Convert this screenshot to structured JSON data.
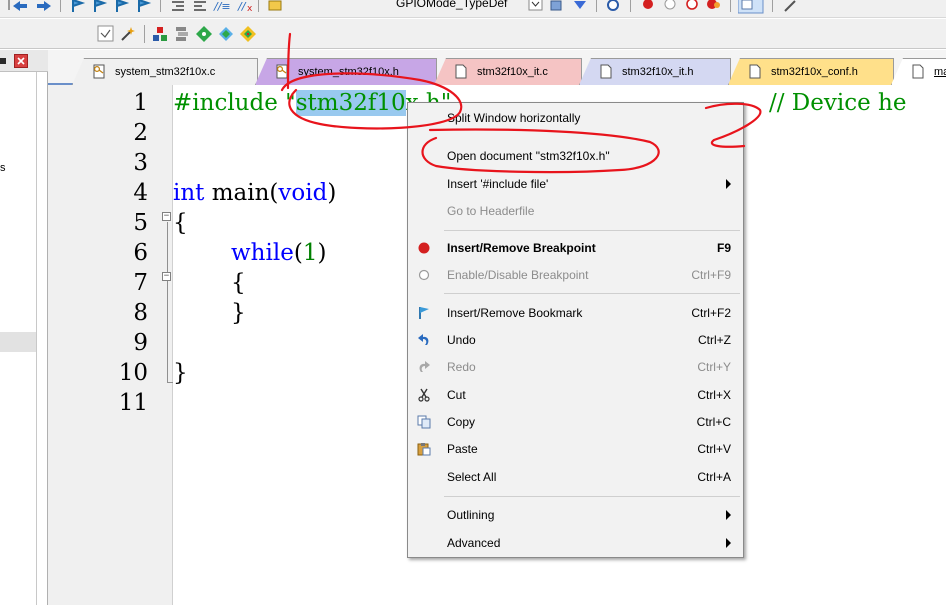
{
  "toolbar": {
    "combo_value": "GPIOMode_TypeDef"
  },
  "left_panel": {
    "partial_text": "s"
  },
  "tabs": [
    {
      "label": "system_stm32f10x.c",
      "color": "#f0f0f0",
      "icon": "file-key-icon"
    },
    {
      "label": "system_stm32f10x.h",
      "color": "#c7a6e6",
      "icon": "file-key-icon"
    },
    {
      "label": "stm32f10x_it.c",
      "color": "#f5c4c4",
      "icon": "file-icon"
    },
    {
      "label": "stm32f10x_it.h",
      "color": "#d4d8f2",
      "icon": "file-icon"
    },
    {
      "label": "stm32f10x_conf.h",
      "color": "#ffe08a",
      "icon": "file-icon"
    },
    {
      "label": "mai",
      "color": "#ffffff",
      "icon": "file-icon"
    }
  ],
  "editor": {
    "line_numbers": [
      "1",
      "2",
      "3",
      "4",
      "5",
      "6",
      "7",
      "8",
      "9",
      "10",
      "11"
    ],
    "code": {
      "l1_directive": "#include",
      "l1_quote_open": " \"",
      "l1_selected": "stm32f10",
      "l1_rest": "x.h\"",
      "l1_comment": "// Device he",
      "l4_type": "int",
      "l4_name": " main(",
      "l4_param": "void",
      "l4_close": ")",
      "l5": "{",
      "l6_kw": "while",
      "l6_open": "(",
      "l6_num": "1",
      "l6_close": ")",
      "l7": "{",
      "l8": "}",
      "l10": "}"
    }
  },
  "context_menu": {
    "items": [
      {
        "label": "Split Window horizontally",
        "shortcut": "",
        "icon": ""
      },
      {
        "label": "Open document \"stm32f10x.h\"",
        "shortcut": "",
        "icon": ""
      },
      {
        "label": "Insert '#include file'",
        "shortcut": "",
        "icon": "",
        "submenu": true
      },
      {
        "label": "Go to Headerfile",
        "shortcut": "",
        "icon": "",
        "disabled": true
      },
      {
        "label": "Insert/Remove Breakpoint",
        "shortcut": "F9",
        "icon": "breakpoint-icon",
        "bold": true
      },
      {
        "label": "Enable/Disable Breakpoint",
        "shortcut": "Ctrl+F9",
        "icon": "breakpoint-disable-icon",
        "disabled": true
      },
      {
        "label": "Insert/Remove Bookmark",
        "shortcut": "Ctrl+F2",
        "icon": "bookmark-flag-icon"
      },
      {
        "label": "Undo",
        "shortcut": "Ctrl+Z",
        "icon": "undo-icon"
      },
      {
        "label": "Redo",
        "shortcut": "Ctrl+Y",
        "icon": "redo-icon",
        "disabled": true
      },
      {
        "label": "Cut",
        "shortcut": "Ctrl+X",
        "icon": "cut-icon"
      },
      {
        "label": "Copy",
        "shortcut": "Ctrl+C",
        "icon": "copy-icon"
      },
      {
        "label": "Paste",
        "shortcut": "Ctrl+V",
        "icon": "paste-icon"
      },
      {
        "label": "Select All",
        "shortcut": "Ctrl+A",
        "icon": ""
      },
      {
        "label": "Outlining",
        "shortcut": "",
        "icon": "",
        "submenu": true
      },
      {
        "label": "Advanced",
        "shortcut": "",
        "icon": "",
        "submenu": true
      }
    ]
  },
  "annotation_color": "#e8141c",
  "accent_color": "#6a8fc9"
}
